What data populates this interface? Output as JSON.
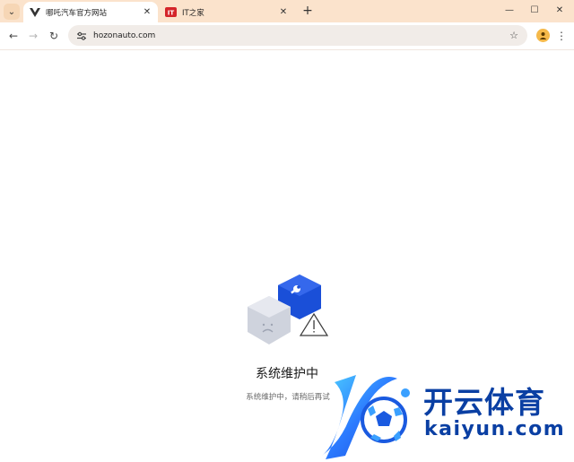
{
  "tabs": [
    {
      "title": "哪吒汽车官方网站",
      "favicon": "nezha-logo-icon",
      "active": true
    },
    {
      "title": "IT之家",
      "favicon": "ithome-logo-icon",
      "badge": "IT",
      "active": false
    }
  ],
  "toolbar": {
    "url": "hozonauto.com"
  },
  "page": {
    "maintenance_title": "系统维护中",
    "maintenance_subtitle": "系统维护中，请稍后再试"
  },
  "watermark": {
    "name_cn": "开云体育",
    "name_en": "kaiyun.com"
  },
  "colors": {
    "tabstrip": "#fbe3cc",
    "accent_blue": "#1a4fd8",
    "watermark_blue": "#0a3fa3"
  }
}
